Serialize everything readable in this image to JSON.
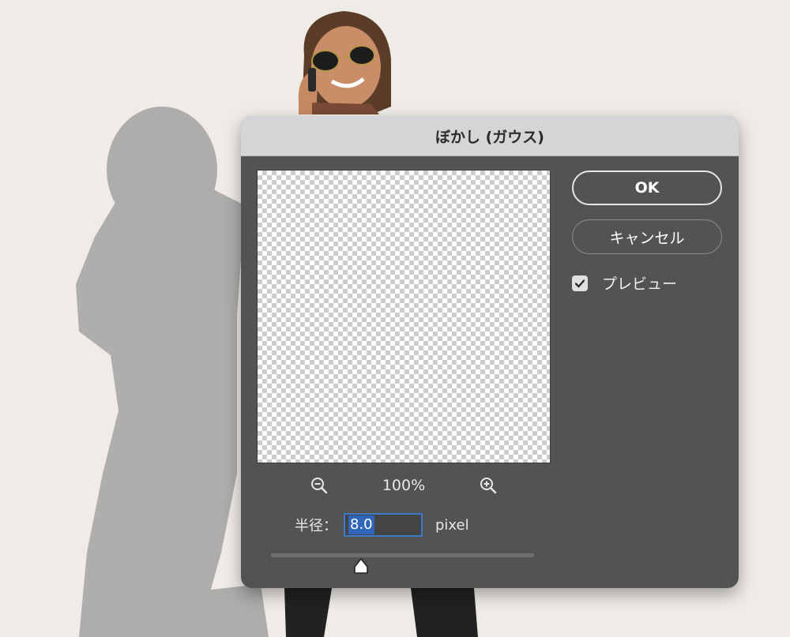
{
  "dialog": {
    "title": "ぼかし (ガウス)",
    "zoom_out_icon": "zoom-out-icon",
    "zoom_in_icon": "zoom-in-icon",
    "zoom_level": "100%",
    "radius_label": "半径：",
    "radius_value": "8.0",
    "radius_unit": "pixel",
    "ok_label": "OK",
    "cancel_label": "キャンセル",
    "preview_label": "プレビュー",
    "preview_checked": true,
    "accent": "#2f66b9"
  }
}
